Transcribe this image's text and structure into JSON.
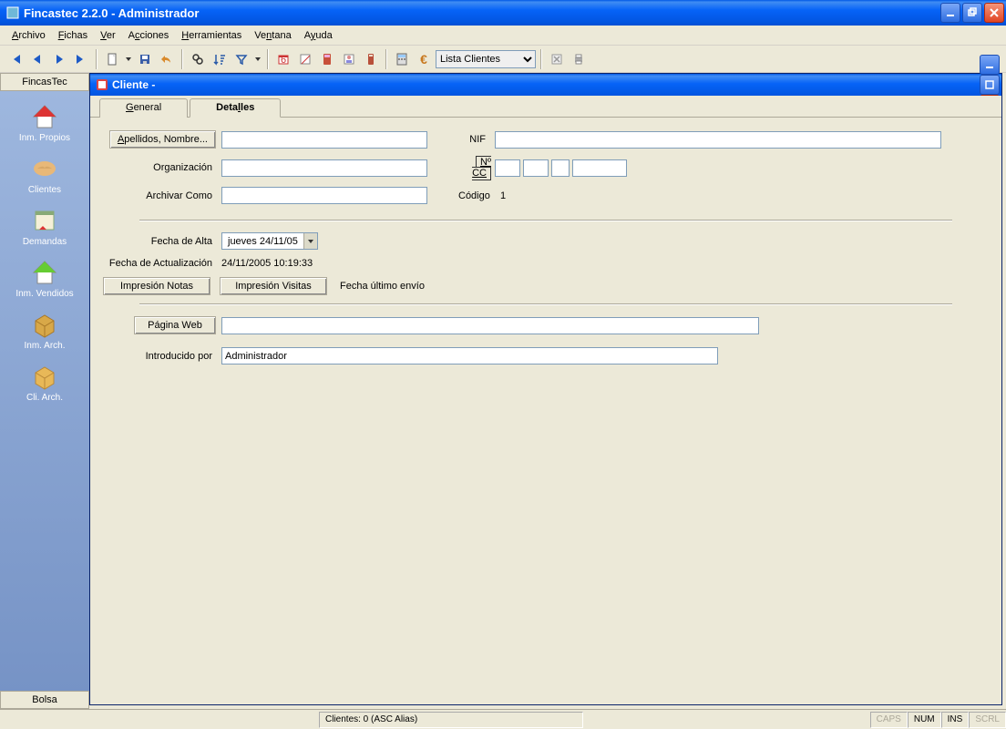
{
  "window": {
    "title": "Fincastec 2.2.0 - Administrador"
  },
  "menu": {
    "archivo": "Archivo",
    "fichas": "Fichas",
    "ver": "Ver",
    "acciones": "Acciones",
    "herramientas": "Herramientas",
    "ventana": "Ventana",
    "ayuda": "Ayuda"
  },
  "toolbar": {
    "combo_value": "Lista Clientes"
  },
  "sidebar": {
    "header": "FincasTec",
    "footer": "Bolsa",
    "items": [
      {
        "label": "Inm. Propios"
      },
      {
        "label": "Clientes"
      },
      {
        "label": "Demandas"
      },
      {
        "label": "Inm. Vendidos"
      },
      {
        "label": "Inm. Arch."
      },
      {
        "label": "Cli. Arch."
      }
    ]
  },
  "subwindow": {
    "title": "Cliente -"
  },
  "tabs": {
    "general": "General",
    "detalles": "Detalles"
  },
  "form": {
    "apellidos_btn": "Apellidos, Nombre...",
    "nif_label": "NIF",
    "organizacion_label": "Organización",
    "ncc_label": "Nº CC",
    "archivar_label": "Archivar Como",
    "codigo_label": "Código",
    "codigo_value": "1",
    "fecha_alta_label": "Fecha de Alta",
    "fecha_alta_value": "jueves   24/11/05",
    "fecha_act_label": "Fecha de Actualización",
    "fecha_act_value": "24/11/2005 10:19:33",
    "imp_notas_btn": "Impresión Notas",
    "imp_visitas_btn": "Impresión Visitas",
    "fecha_envio_label": "Fecha último envío",
    "pagina_web_btn": "Página Web",
    "introducido_label": "Introducido por",
    "introducido_value": "Administrador"
  },
  "status": {
    "clientes": "Clientes: 0   (ASC Alias)",
    "caps": "CAPS",
    "num": "NUM",
    "ins": "INS",
    "scrl": "SCRL"
  }
}
